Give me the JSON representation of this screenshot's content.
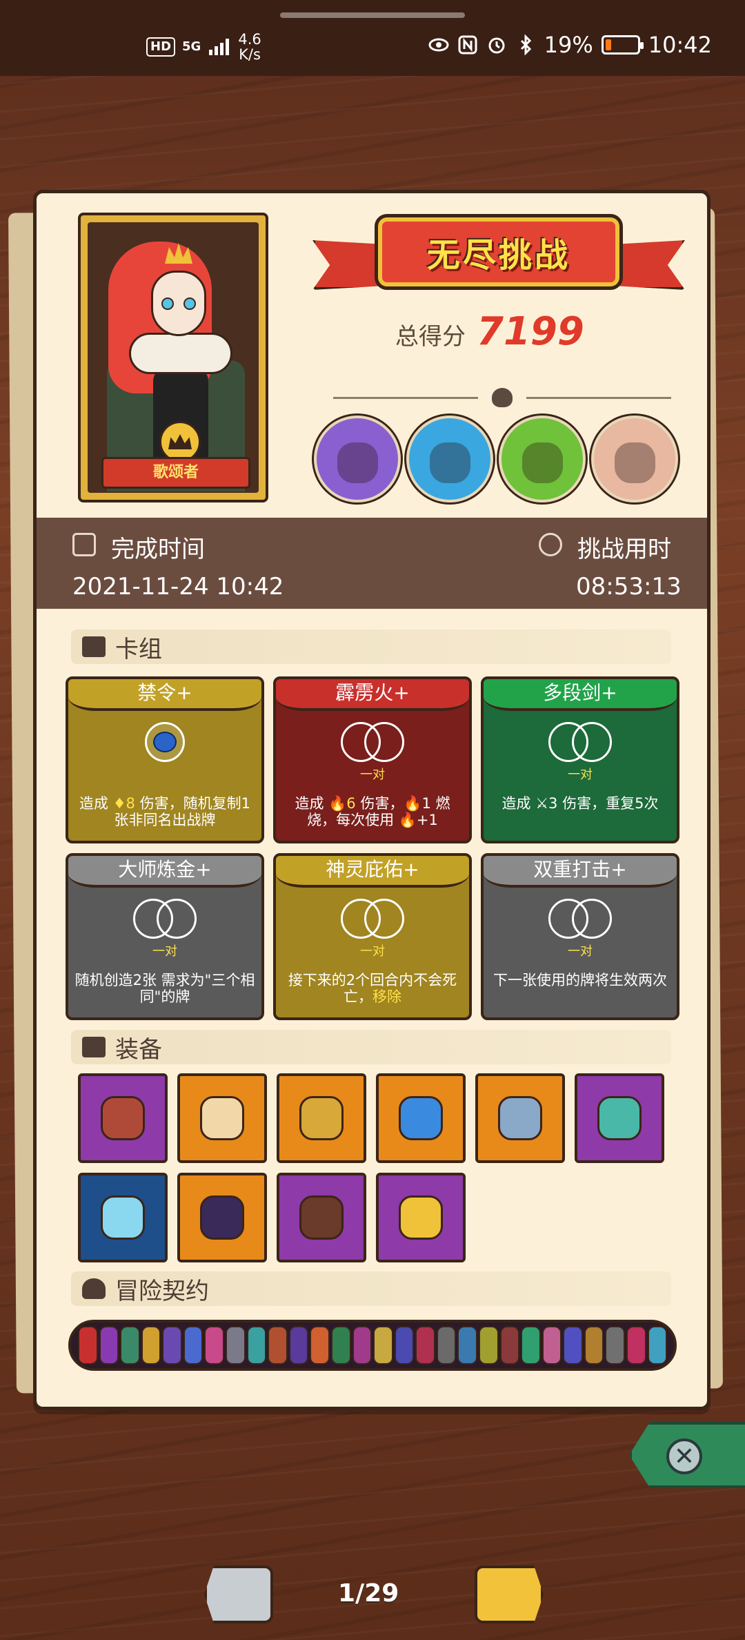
{
  "status_bar": {
    "hd": "HD",
    "signal": "5G",
    "speed_value": "4.6",
    "speed_unit": "K/s",
    "battery": "19%",
    "battery_level": 0.19,
    "time": "10:42"
  },
  "character": {
    "name": "歌颂者"
  },
  "header": {
    "title": "无尽挑战",
    "score_label": "总得分",
    "score_value": "7199"
  },
  "bosses": [
    {
      "icon": "purple-monster-boss-icon",
      "color": "#8a5fd0"
    },
    {
      "icon": "blue-crowned-boss-icon",
      "color": "#3aa7e0"
    },
    {
      "icon": "green-goblin-boss-icon",
      "color": "#6fc23a"
    },
    {
      "icon": "red-mask-boss-icon",
      "color": "#e8b8a0"
    }
  ],
  "time_info": {
    "finish_label": "完成时间",
    "finish_value": "2021-11-24 10:42",
    "duration_label": "挑战用时",
    "duration_value": "08:53:13"
  },
  "sections": {
    "deck": "卡组",
    "equipment": "装备",
    "contract": "冒险契约"
  },
  "cards": [
    {
      "title": "禁令+",
      "color": "#a08520",
      "title_color": "#c2a127",
      "art": "orb",
      "tag": "",
      "desc_a": "造成 ",
      "desc_hl": "♦8",
      "desc_b": " 伤害，随机复制1张非同名出战牌"
    },
    {
      "title": "霹雳火+",
      "color": "#7a1f1c",
      "title_color": "#c8302c",
      "art": "rings",
      "tag": "一对",
      "desc_a": "造成 ",
      "desc_hl": "🔥6",
      "desc_b": " 伤害，🔥1 燃烧，每次使用 🔥+1"
    },
    {
      "title": "多段剑+",
      "color": "#1d6a3a",
      "title_color": "#22a34a",
      "art": "rings",
      "tag": "一对",
      "desc_a": "造成 ",
      "desc_hl": "",
      "desc_b": "⚔3 伤害，重复5次"
    },
    {
      "title": "大师炼金+",
      "color": "#5a5a5a",
      "title_color": "#8a8a8a",
      "art": "rings",
      "tag": "一对",
      "desc_a": "随机创造2张 需求为\"三个相同\"的牌",
      "desc_hl": "",
      "desc_b": ""
    },
    {
      "title": "神灵庇佑+",
      "color": "#a08520",
      "title_color": "#c2a127",
      "art": "rings",
      "tag": "一对",
      "desc_a": "接下来的2个回合内不会死亡，",
      "desc_hl": "移除",
      "desc_b": ""
    },
    {
      "title": "双重打击+",
      "color": "#5a5a5a",
      "title_color": "#8a8a8a",
      "art": "rings",
      "tag": "一对",
      "desc_a": "下一张使用的牌将生效两次",
      "desc_hl": "",
      "desc_b": ""
    }
  ],
  "equipment": [
    {
      "icon": "red-stone-icon",
      "bg": "#8e3aa8",
      "fg": "#b04a38"
    },
    {
      "icon": "scroll-disc-icon",
      "bg": "#e88a1a",
      "fg": "#f2d8a8"
    },
    {
      "icon": "lion-ring-icon",
      "bg": "#e88a1a",
      "fg": "#d8a838"
    },
    {
      "icon": "blue-slime-icon",
      "bg": "#e88a1a",
      "fg": "#3a8ae0"
    },
    {
      "icon": "serrated-blade-icon",
      "bg": "#e88a1a",
      "fg": "#8aa8c8"
    },
    {
      "icon": "eye-amulet-icon",
      "bg": "#8e3aa8",
      "fg": "#4ab8a8"
    },
    {
      "icon": "blue-gem-icon",
      "bg": "#1e4f8a",
      "fg": "#8ad8f0"
    },
    {
      "icon": "triangle-star-icon",
      "bg": "#e88a1a",
      "fg": "#3a2a5a"
    },
    {
      "icon": "button-disc-icon",
      "bg": "#8e3aa8",
      "fg": "#6a3a2a"
    },
    {
      "icon": "golden-chalice-icon",
      "bg": "#8e3aa8",
      "fg": "#f0c23a"
    }
  ],
  "contract_colors": [
    "#c83030",
    "#8a3ab0",
    "#3a8a6a",
    "#d0a030",
    "#6a4ab0",
    "#4a6ad0",
    "#c84a8a",
    "#7a7a8a",
    "#3aa0a0",
    "#b05030",
    "#5a3a9a",
    "#d06030",
    "#308050",
    "#a03a8a",
    "#c8a840",
    "#4a4ab0",
    "#b03050",
    "#6a6a6a",
    "#3a7ab0",
    "#a0a030",
    "#8a3a3a",
    "#30a070",
    "#c06090",
    "#5050c0",
    "#b08030",
    "#707070",
    "#c03060",
    "#40a0c0"
  ],
  "nav": {
    "pager": "1/29"
  }
}
